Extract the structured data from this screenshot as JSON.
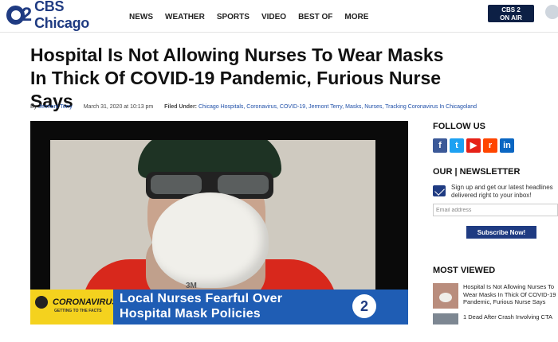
{
  "header": {
    "logo_num": "2",
    "logo_name": "CBS Chicago",
    "nav": [
      "NEWS",
      "WEATHER",
      "SPORTS",
      "VIDEO",
      "BEST OF",
      "MORE"
    ],
    "on_air_line1": "CBS 2",
    "on_air_line2": "ON AIR"
  },
  "article": {
    "headline": "Hospital Is Not Allowing Nurses To Wear Masks In Thick Of COVID-19 Pandemic, Furious Nurse Says",
    "byline_prefix": "By",
    "author": "Jermont Terry",
    "date": "March 31, 2020 at 10:13 pm",
    "filed_under_label": "Filed Under:",
    "tags_text": "Chicago Hospitals, Coronavirus, COVID-19, Jermont Terry, Masks, Nurses, Tracking Coronavirus In Chicagoland"
  },
  "video": {
    "mask_brand": "3M",
    "lower_third_title": "CORONAVIRUS",
    "lower_third_sub": "GETTING TO THE FACTS",
    "lower_third_line1": "Local Nurses Fearful Over",
    "lower_third_line2": "Hospital Mask Policies",
    "channel_logo": "2"
  },
  "sidebar": {
    "follow_heading": "FOLLOW US",
    "socials": [
      {
        "icon": "facebook-icon",
        "glyph": "f",
        "color": "#3b5998"
      },
      {
        "icon": "twitter-icon",
        "glyph": "t",
        "color": "#1da1f2"
      },
      {
        "icon": "youtube-icon",
        "glyph": "▶",
        "color": "#e62117"
      },
      {
        "icon": "reddit-icon",
        "glyph": "r",
        "color": "#ff4500"
      },
      {
        "icon": "linkedin-icon",
        "glyph": "in",
        "color": "#0a66c2"
      }
    ],
    "newsletter_heading": "OUR | NEWSLETTER",
    "newsletter_text": "Sign up and get our latest headlines delivered right to your inbox!",
    "email_placeholder": "Email address",
    "subscribe_label": "Subscribe Now!",
    "most_viewed_heading": "MOST VIEWED",
    "most_viewed": [
      "Hospital Is Not Allowing Nurses To Wear Masks In Thick Of COVID-19 Pandemic, Furious Nurse Says",
      "1 Dead After Crash Involving CTA"
    ]
  },
  "colors": {
    "brand_blue": "#1f3b82",
    "link_blue": "#1f4fa8",
    "lower_third_yellow": "#f4d21e",
    "lower_third_blue": "#1f5db4"
  }
}
